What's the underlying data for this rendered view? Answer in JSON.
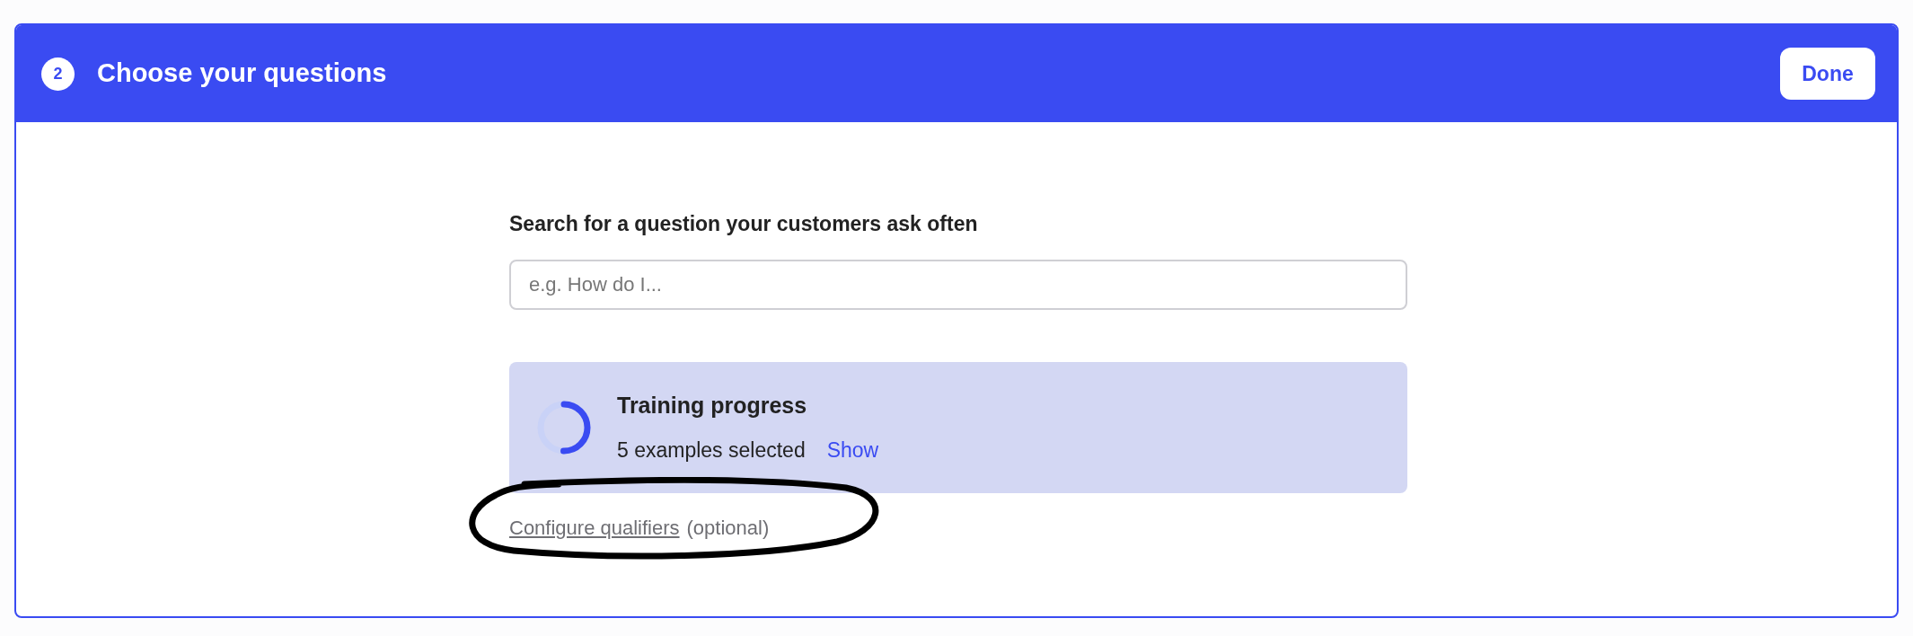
{
  "header": {
    "step": "2",
    "title": "Choose your questions",
    "done_button": "Done"
  },
  "search": {
    "label": "Search for a question your customers ask often",
    "placeholder": "e.g. How do I..."
  },
  "training": {
    "title": "Training progress",
    "summary": "5 examples selected",
    "link": "Show"
  },
  "qualifiers": {
    "link": "Configure qualifiers",
    "note": "(optional)"
  }
}
